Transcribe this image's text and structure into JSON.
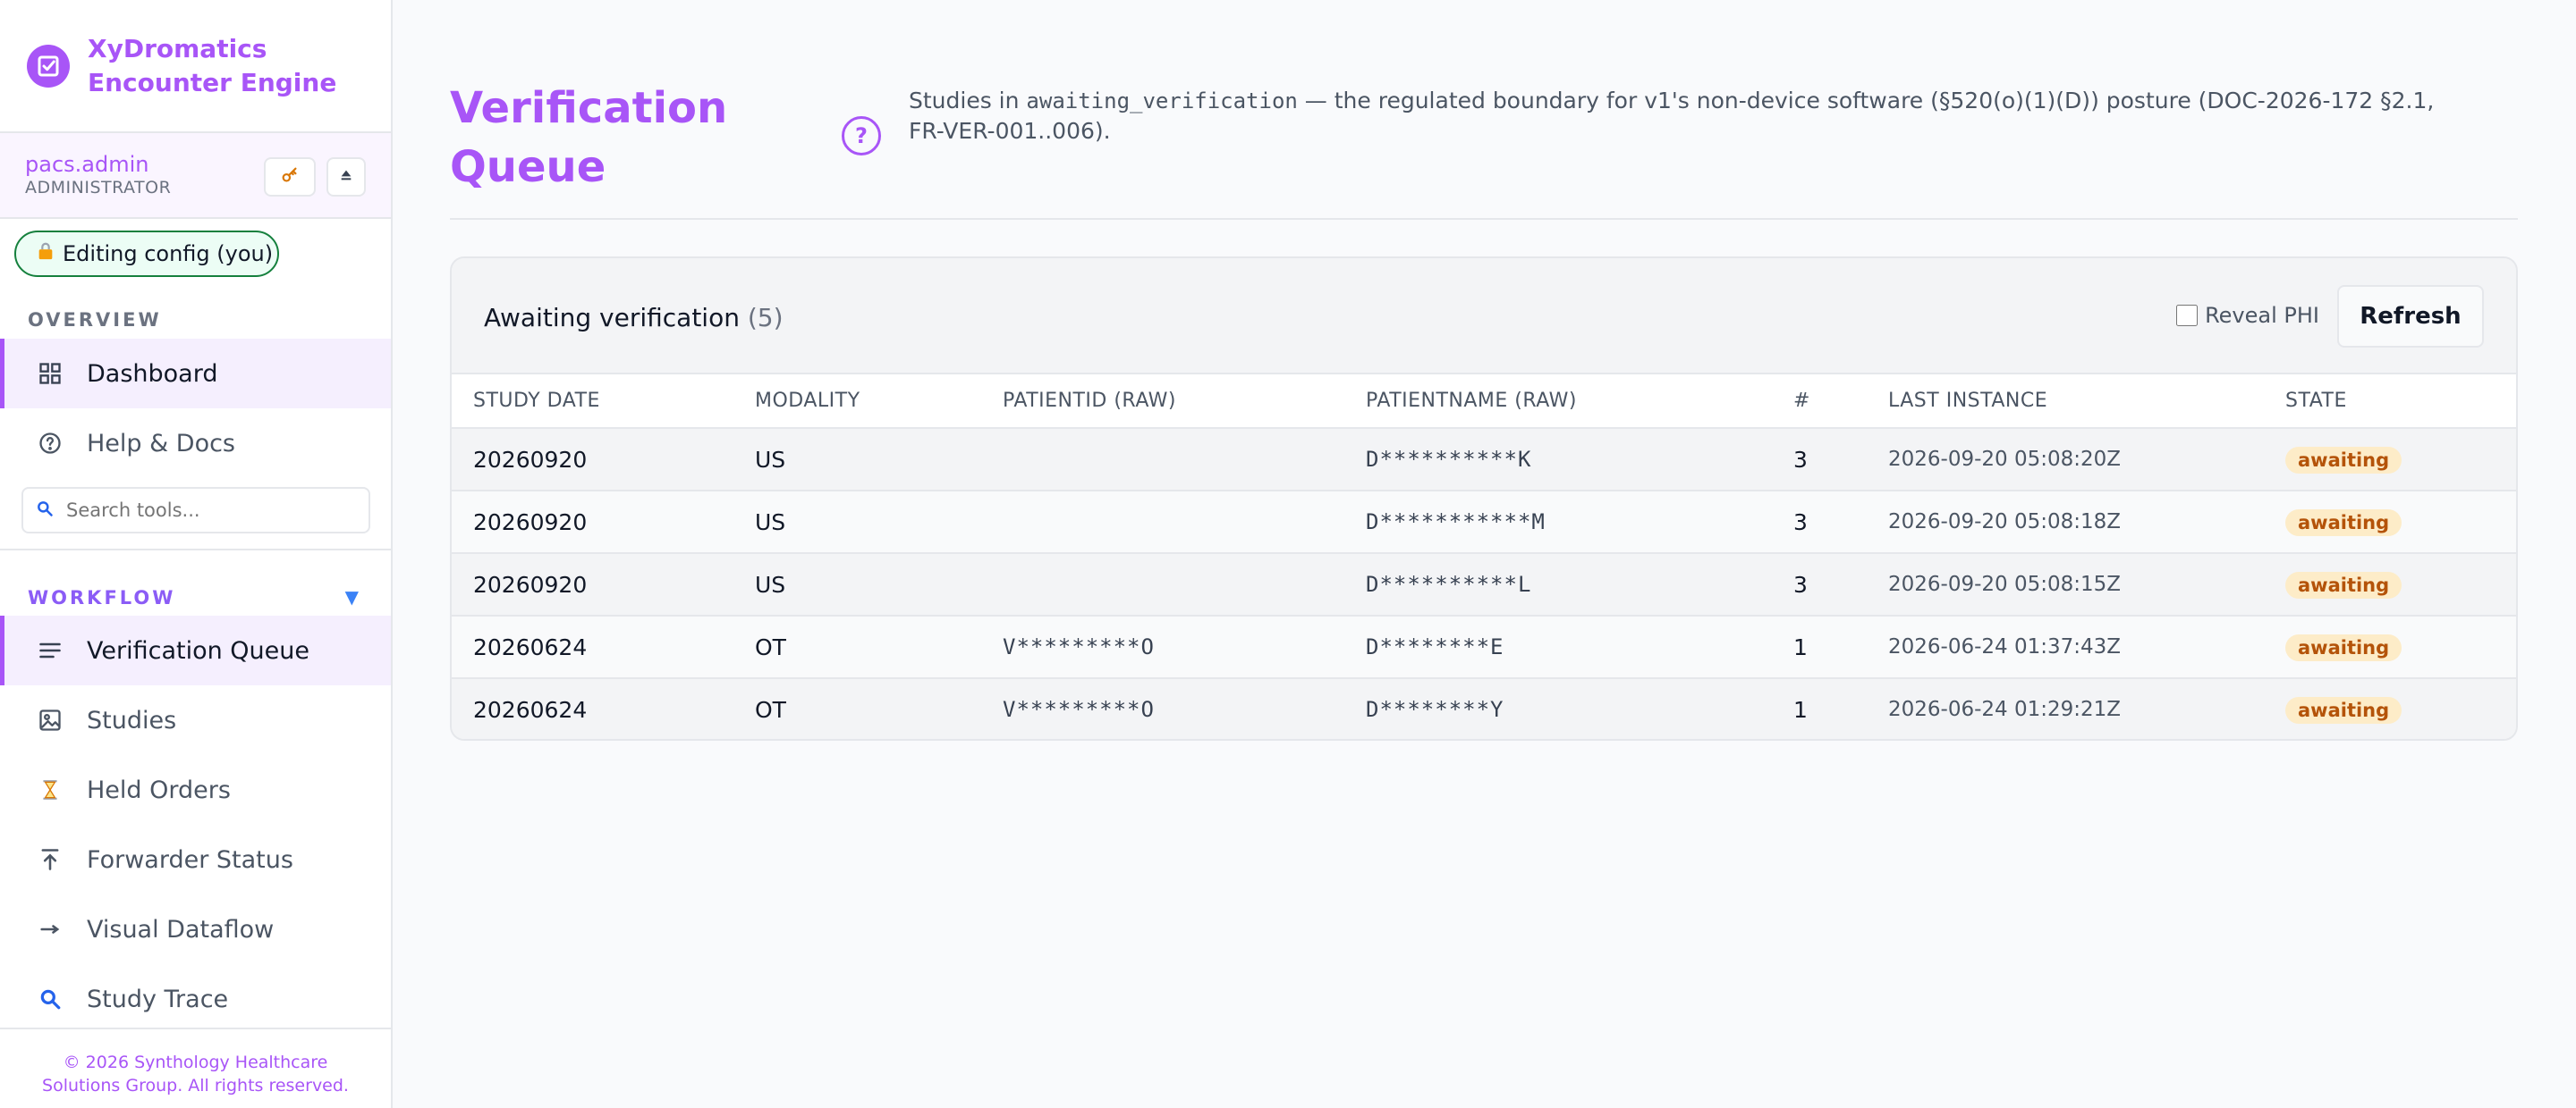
{
  "brand": {
    "line1": "XyDromatics",
    "line2": "Encounter Engine",
    "accent": "#a855f7"
  },
  "user": {
    "name": "pacs.admin",
    "role": "ADMINISTRATOR",
    "key_icon": "key-icon",
    "eject_icon": "eject-icon"
  },
  "lock": {
    "label": "Editing config (you)"
  },
  "sidebar": {
    "overview_label": "OVERVIEW",
    "workflow_label": "WORKFLOW",
    "overview_items": [
      {
        "label": "Dashboard",
        "icon": "grid-icon"
      },
      {
        "label": "Help & Docs",
        "icon": "question-icon"
      }
    ],
    "search_placeholder": "Search tools...",
    "workflow_items": [
      {
        "label": "Verification Queue",
        "icon": "list-icon"
      },
      {
        "label": "Studies",
        "icon": "image-icon"
      },
      {
        "label": "Held Orders",
        "icon": "hourglass-icon"
      },
      {
        "label": "Forwarder Status",
        "icon": "upload-arrow-icon"
      },
      {
        "label": "Visual Dataflow",
        "icon": "arrow-right-icon"
      },
      {
        "label": "Study Trace",
        "icon": "magnifier-icon"
      }
    ],
    "footer_line1": "© 2026 Synthology Healthcare",
    "footer_line2": "Solutions Group. All rights reserved."
  },
  "page": {
    "title": "Verification Queue",
    "desc_prefix": "Studies in ",
    "desc_code": "awaiting_verification",
    "desc_suffix": " — the regulated boundary for v1's non-device software (§520(o)(1)(D)) posture (DOC-2026-172 §2.1, FR-VER-001..006)."
  },
  "card": {
    "title": "Awaiting verification",
    "count": "(5)",
    "reveal_label": "Reveal PHI",
    "refresh_label": "Refresh"
  },
  "table": {
    "columns": [
      "STUDY DATE",
      "MODALITY",
      "PATIENTID (RAW)",
      "PATIENTNAME (RAW)",
      "#",
      "LAST INSTANCE",
      "STATE"
    ],
    "rows": [
      [
        "20260920",
        "US",
        "",
        "D**********K",
        "3",
        "2026-09-20 05:08:20Z",
        "awaiting"
      ],
      [
        "20260920",
        "US",
        "",
        "D***********M",
        "3",
        "2026-09-20 05:08:18Z",
        "awaiting"
      ],
      [
        "20260920",
        "US",
        "",
        "D**********L",
        "3",
        "2026-09-20 05:08:15Z",
        "awaiting"
      ],
      [
        "20260624",
        "OT",
        "V*********O",
        "D********E",
        "1",
        "2026-06-24 01:37:43Z",
        "awaiting"
      ],
      [
        "20260624",
        "OT",
        "V*********O",
        "D********Y",
        "1",
        "2026-06-24 01:29:21Z",
        "awaiting"
      ]
    ]
  }
}
